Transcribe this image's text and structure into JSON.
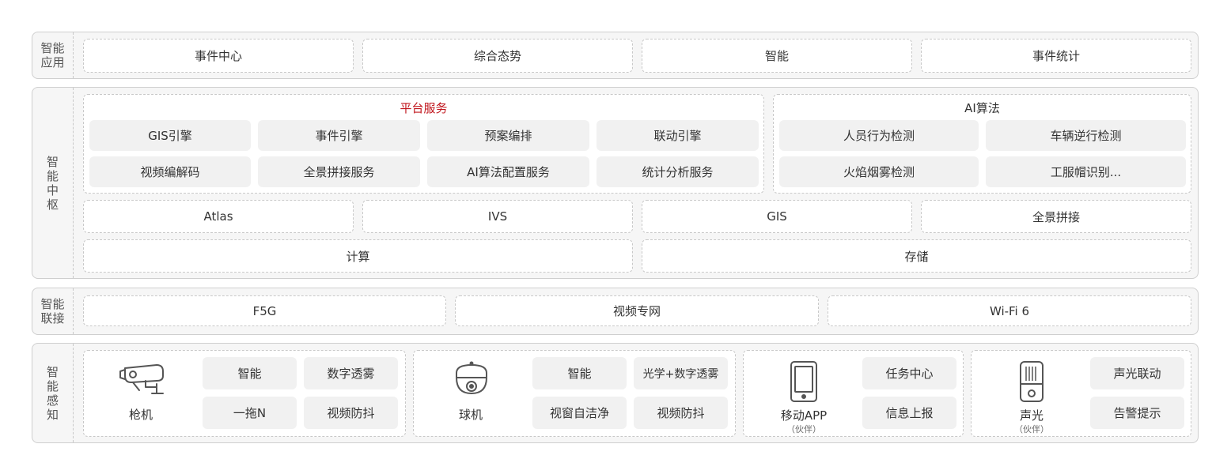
{
  "colors": {
    "accent": "#c0141b",
    "border": "#c8c8c8",
    "chip_bg": "#f1f1f1",
    "layer_bg": "#f6f6f6"
  },
  "layers": {
    "app": {
      "label": "智能\n应用",
      "items": [
        "事件中心",
        "综合态势",
        "智能",
        "事件统计"
      ]
    },
    "hub": {
      "label": "智能中枢",
      "platform": {
        "title": "平台服务",
        "items": [
          "GIS引擎",
          "事件引擎",
          "预案编排",
          "联动引擎",
          "视频编解码",
          "全景拼接服务",
          "AI算法配置服务",
          "统计分析服务"
        ]
      },
      "ai": {
        "title": "AI算法",
        "items": [
          "人员行为检测",
          "车辆逆行检测",
          "火焰烟雾检测",
          "工服帽识别..."
        ]
      },
      "row2": [
        "Atlas",
        "IVS",
        "GIS",
        "全景拼接"
      ],
      "row3": [
        "计算",
        "存储"
      ]
    },
    "connect": {
      "label": "智能\n联接",
      "items": [
        "F5G",
        "视频专网",
        "Wi-Fi 6"
      ]
    },
    "sense": {
      "label": "智能感知",
      "devices": [
        {
          "name": "枪机",
          "sub": "",
          "icon": "bullet-camera-icon",
          "features": [
            "智能",
            "数字透雾",
            "一拖N",
            "视频防抖"
          ]
        },
        {
          "name": "球机",
          "sub": "",
          "icon": "dome-camera-icon",
          "features": [
            "智能",
            "光学+数字透雾",
            "视窗自洁净",
            "视频防抖"
          ]
        },
        {
          "name": "移动APP",
          "sub": "（伙伴）",
          "icon": "mobile-phone-icon",
          "features": [
            "任务中心",
            "信息上报"
          ]
        },
        {
          "name": "声光",
          "sub": "（伙伴）",
          "icon": "sound-light-alarm-icon",
          "features": [
            "声光联动",
            "告警提示"
          ]
        }
      ]
    }
  }
}
